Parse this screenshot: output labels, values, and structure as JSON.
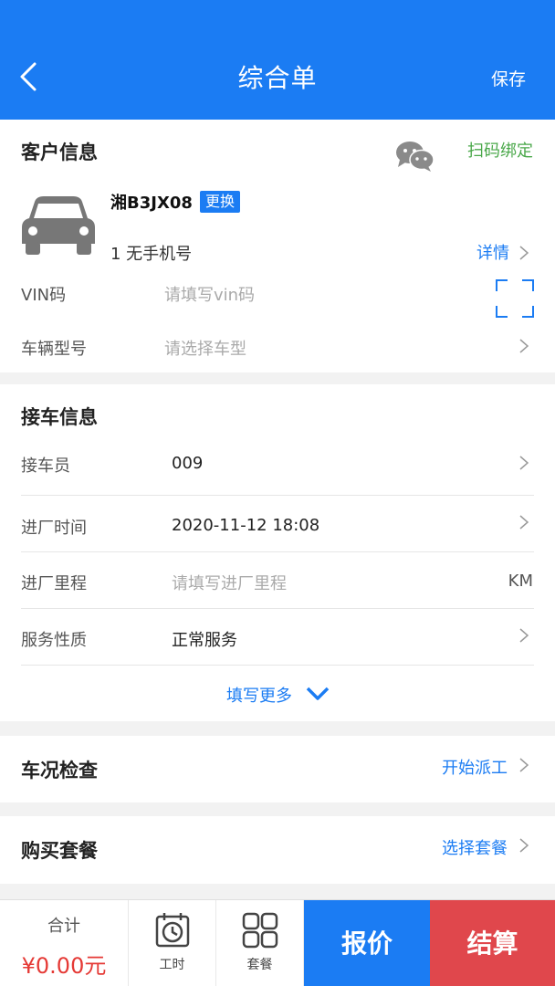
{
  "header": {
    "title": "综合单",
    "save_label": "保存",
    "back_icon": "chevron-left-icon"
  },
  "customer": {
    "title": "客户信息",
    "scan_bind": "扫码绑定",
    "plate": "湘B3JX08",
    "change_label": "更换",
    "owner": "1  无手机号",
    "detail_label": "详情",
    "vin_label": "VIN码",
    "vin_placeholder": "请填写vin码",
    "model_label": "车辆型号",
    "model_placeholder": "请选择车型"
  },
  "pickup": {
    "title": "接车信息",
    "rows": [
      {
        "label": "接车员",
        "value": "009"
      },
      {
        "label": "进厂时间",
        "value": "2020-11-12 18:08"
      },
      {
        "label": "进厂里程",
        "placeholder": "请填写进厂里程",
        "unit": "KM"
      },
      {
        "label": "服务性质",
        "value": "正常服务"
      }
    ],
    "more_label": "填写更多"
  },
  "check": {
    "title": "车况检查",
    "action": "开始派工"
  },
  "package": {
    "title": "购买套餐",
    "action": "选择套餐"
  },
  "bottom": {
    "total_label": "合计",
    "total_amount": "¥0.00元",
    "tab_labor": "工时",
    "tab_package": "套餐",
    "quote_label": "报价",
    "settle_label": "结算"
  },
  "colors": {
    "primary": "#1b7cf3",
    "danger": "#e0474c",
    "success": "#4aa84a",
    "price": "#e53935"
  }
}
